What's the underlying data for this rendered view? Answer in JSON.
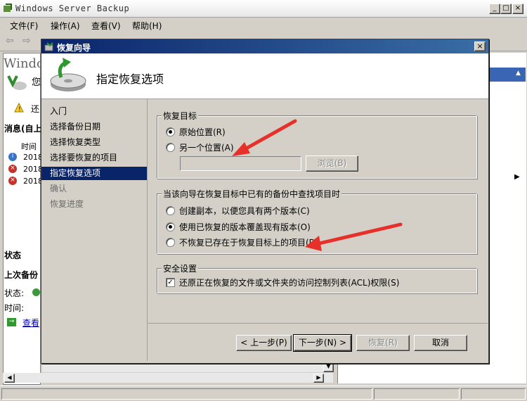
{
  "window": {
    "title": "Windows Server Backup",
    "icon": "server-backup-icon"
  },
  "menu": [
    "文件(F)",
    "操作(A)",
    "查看(V)",
    "帮助(H)"
  ],
  "background": {
    "left_fragments": [
      "Windo",
      "您",
      "还",
      "消息(自上",
      "时间",
      "2018",
      "2018",
      "2018",
      "状态",
      "上次备份",
      "状态:",
      "时间:",
      "查看"
    ]
  },
  "dialog": {
    "title": "恢复向导",
    "header_title": "指定恢复选项",
    "nav": [
      {
        "label": "入门",
        "state": "normal"
      },
      {
        "label": "选择备份日期",
        "state": "normal"
      },
      {
        "label": "选择恢复类型",
        "state": "normal"
      },
      {
        "label": "选择要恢复的项目",
        "state": "normal"
      },
      {
        "label": "指定恢复选项",
        "state": "selected"
      },
      {
        "label": "确认",
        "state": "dim"
      },
      {
        "label": "恢复进度",
        "state": "dim"
      }
    ],
    "group1": {
      "legend": "恢复目标",
      "opt1": "原始位置(R)",
      "opt2": "另一个位置(A)",
      "path_value": "",
      "browse": "浏览(B)",
      "selected": "opt1"
    },
    "group2": {
      "legend": "当该向导在恢复目标中已有的备份中查找项目时",
      "opt1": "创建副本，以便您具有两个版本(C)",
      "opt2": "使用已恢复的版本覆盖现有版本(O)",
      "opt3": "不恢复已存在于恢复目标上的项目(D)",
      "selected": "opt2"
    },
    "group3": {
      "legend": "安全设置",
      "check_label": "还原正在恢复的文件或文件夹的访问控制列表(ACL)权限(S)",
      "checked": true
    },
    "buttons": {
      "back": "< 上一步(P)",
      "next": "下一步(N) >",
      "recover": "恢复(R)",
      "cancel": "取消"
    },
    "annotation_color": "#e8302a"
  }
}
